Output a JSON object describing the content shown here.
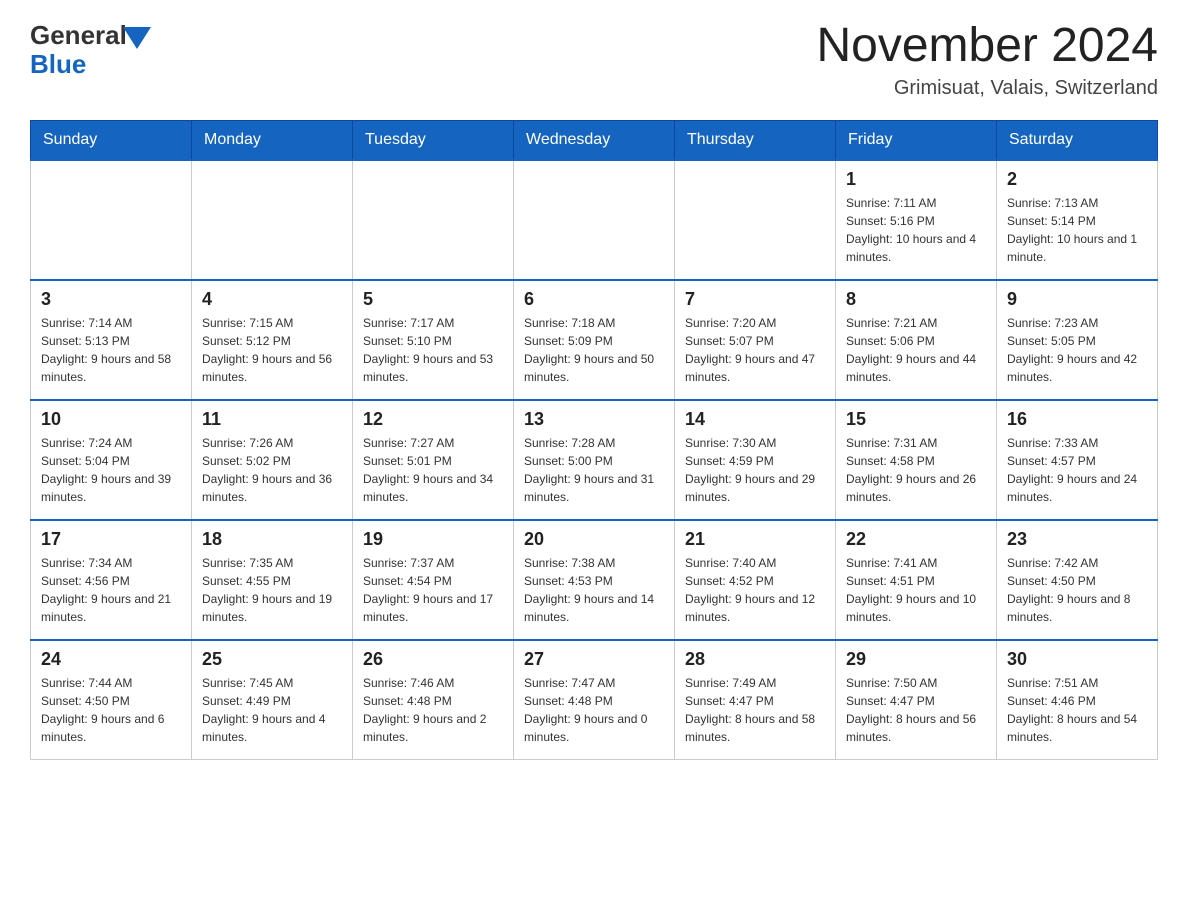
{
  "header": {
    "logo": {
      "general": "General",
      "blue": "Blue"
    },
    "title": "November 2024",
    "location": "Grimisuat, Valais, Switzerland"
  },
  "days_of_week": [
    "Sunday",
    "Monday",
    "Tuesday",
    "Wednesday",
    "Thursday",
    "Friday",
    "Saturday"
  ],
  "weeks": [
    [
      {
        "day": "",
        "info": ""
      },
      {
        "day": "",
        "info": ""
      },
      {
        "day": "",
        "info": ""
      },
      {
        "day": "",
        "info": ""
      },
      {
        "day": "",
        "info": ""
      },
      {
        "day": "1",
        "info": "Sunrise: 7:11 AM\nSunset: 5:16 PM\nDaylight: 10 hours and 4 minutes."
      },
      {
        "day": "2",
        "info": "Sunrise: 7:13 AM\nSunset: 5:14 PM\nDaylight: 10 hours and 1 minute."
      }
    ],
    [
      {
        "day": "3",
        "info": "Sunrise: 7:14 AM\nSunset: 5:13 PM\nDaylight: 9 hours and 58 minutes."
      },
      {
        "day": "4",
        "info": "Sunrise: 7:15 AM\nSunset: 5:12 PM\nDaylight: 9 hours and 56 minutes."
      },
      {
        "day": "5",
        "info": "Sunrise: 7:17 AM\nSunset: 5:10 PM\nDaylight: 9 hours and 53 minutes."
      },
      {
        "day": "6",
        "info": "Sunrise: 7:18 AM\nSunset: 5:09 PM\nDaylight: 9 hours and 50 minutes."
      },
      {
        "day": "7",
        "info": "Sunrise: 7:20 AM\nSunset: 5:07 PM\nDaylight: 9 hours and 47 minutes."
      },
      {
        "day": "8",
        "info": "Sunrise: 7:21 AM\nSunset: 5:06 PM\nDaylight: 9 hours and 44 minutes."
      },
      {
        "day": "9",
        "info": "Sunrise: 7:23 AM\nSunset: 5:05 PM\nDaylight: 9 hours and 42 minutes."
      }
    ],
    [
      {
        "day": "10",
        "info": "Sunrise: 7:24 AM\nSunset: 5:04 PM\nDaylight: 9 hours and 39 minutes."
      },
      {
        "day": "11",
        "info": "Sunrise: 7:26 AM\nSunset: 5:02 PM\nDaylight: 9 hours and 36 minutes."
      },
      {
        "day": "12",
        "info": "Sunrise: 7:27 AM\nSunset: 5:01 PM\nDaylight: 9 hours and 34 minutes."
      },
      {
        "day": "13",
        "info": "Sunrise: 7:28 AM\nSunset: 5:00 PM\nDaylight: 9 hours and 31 minutes."
      },
      {
        "day": "14",
        "info": "Sunrise: 7:30 AM\nSunset: 4:59 PM\nDaylight: 9 hours and 29 minutes."
      },
      {
        "day": "15",
        "info": "Sunrise: 7:31 AM\nSunset: 4:58 PM\nDaylight: 9 hours and 26 minutes."
      },
      {
        "day": "16",
        "info": "Sunrise: 7:33 AM\nSunset: 4:57 PM\nDaylight: 9 hours and 24 minutes."
      }
    ],
    [
      {
        "day": "17",
        "info": "Sunrise: 7:34 AM\nSunset: 4:56 PM\nDaylight: 9 hours and 21 minutes."
      },
      {
        "day": "18",
        "info": "Sunrise: 7:35 AM\nSunset: 4:55 PM\nDaylight: 9 hours and 19 minutes."
      },
      {
        "day": "19",
        "info": "Sunrise: 7:37 AM\nSunset: 4:54 PM\nDaylight: 9 hours and 17 minutes."
      },
      {
        "day": "20",
        "info": "Sunrise: 7:38 AM\nSunset: 4:53 PM\nDaylight: 9 hours and 14 minutes."
      },
      {
        "day": "21",
        "info": "Sunrise: 7:40 AM\nSunset: 4:52 PM\nDaylight: 9 hours and 12 minutes."
      },
      {
        "day": "22",
        "info": "Sunrise: 7:41 AM\nSunset: 4:51 PM\nDaylight: 9 hours and 10 minutes."
      },
      {
        "day": "23",
        "info": "Sunrise: 7:42 AM\nSunset: 4:50 PM\nDaylight: 9 hours and 8 minutes."
      }
    ],
    [
      {
        "day": "24",
        "info": "Sunrise: 7:44 AM\nSunset: 4:50 PM\nDaylight: 9 hours and 6 minutes."
      },
      {
        "day": "25",
        "info": "Sunrise: 7:45 AM\nSunset: 4:49 PM\nDaylight: 9 hours and 4 minutes."
      },
      {
        "day": "26",
        "info": "Sunrise: 7:46 AM\nSunset: 4:48 PM\nDaylight: 9 hours and 2 minutes."
      },
      {
        "day": "27",
        "info": "Sunrise: 7:47 AM\nSunset: 4:48 PM\nDaylight: 9 hours and 0 minutes."
      },
      {
        "day": "28",
        "info": "Sunrise: 7:49 AM\nSunset: 4:47 PM\nDaylight: 8 hours and 58 minutes."
      },
      {
        "day": "29",
        "info": "Sunrise: 7:50 AM\nSunset: 4:47 PM\nDaylight: 8 hours and 56 minutes."
      },
      {
        "day": "30",
        "info": "Sunrise: 7:51 AM\nSunset: 4:46 PM\nDaylight: 8 hours and 54 minutes."
      }
    ]
  ]
}
